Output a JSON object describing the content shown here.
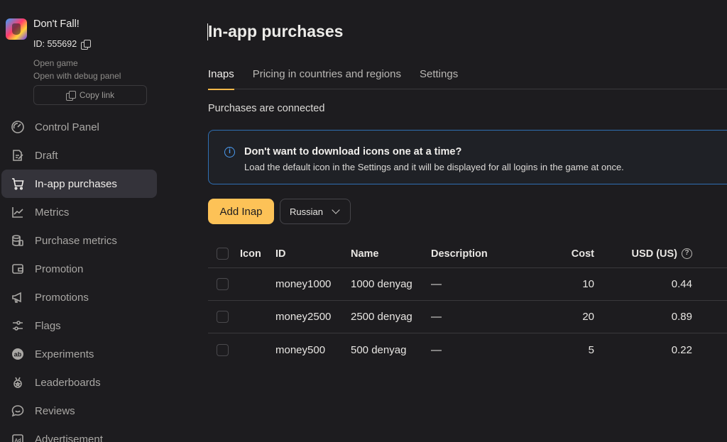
{
  "app": {
    "title": "Don't Fall!",
    "id_label": "ID: 555692",
    "open_game": "Open game",
    "open_debug": "Open with debug panel",
    "copy_link": "Copy link"
  },
  "nav": {
    "items": [
      {
        "label": "Control Panel",
        "icon": "gauge-icon"
      },
      {
        "label": "Draft",
        "icon": "edit-icon"
      },
      {
        "label": "In-app purchases",
        "icon": "cart-icon",
        "active": true
      },
      {
        "label": "Metrics",
        "icon": "line-chart-icon"
      },
      {
        "label": "Purchase metrics",
        "icon": "coins-icon"
      },
      {
        "label": "Promotion",
        "icon": "wallet-icon"
      },
      {
        "label": "Promotions",
        "icon": "megaphone-icon"
      },
      {
        "label": "Flags",
        "icon": "sliders-icon"
      },
      {
        "label": "Experiments",
        "icon": "ab-icon"
      },
      {
        "label": "Leaderboards",
        "icon": "medal-icon"
      },
      {
        "label": "Reviews",
        "icon": "chat-icon"
      },
      {
        "label": "Advertisement",
        "icon": "ad-icon"
      }
    ]
  },
  "main": {
    "title": "In-app purchases",
    "tabs": [
      "Inaps",
      "Pricing in countries and regions",
      "Settings"
    ],
    "status": "Purchases are connected",
    "info": {
      "title": "Don't want to download icons one at a time?",
      "body": "Load the default icon in the Settings and it will be displayed for all logins in the game at once."
    },
    "add_button": "Add Inap",
    "language": "Russian"
  },
  "table": {
    "headers": {
      "icon": "Icon",
      "id": "ID",
      "name": "Name",
      "description": "Description",
      "cost": "Cost",
      "usd": "USD (US)"
    },
    "rows": [
      {
        "id": "money1000",
        "name": "1000 denyag",
        "description": "—",
        "cost": "10",
        "usd": "0.44"
      },
      {
        "id": "money2500",
        "name": "2500 denyag",
        "description": "—",
        "cost": "20",
        "usd": "0.89"
      },
      {
        "id": "money500",
        "name": "500 denyag",
        "description": "—",
        "cost": "5",
        "usd": "0.22"
      }
    ]
  },
  "colors": {
    "accent": "#fdc257",
    "info_border": "#2f6fb3",
    "background": "#1d1c1f"
  }
}
